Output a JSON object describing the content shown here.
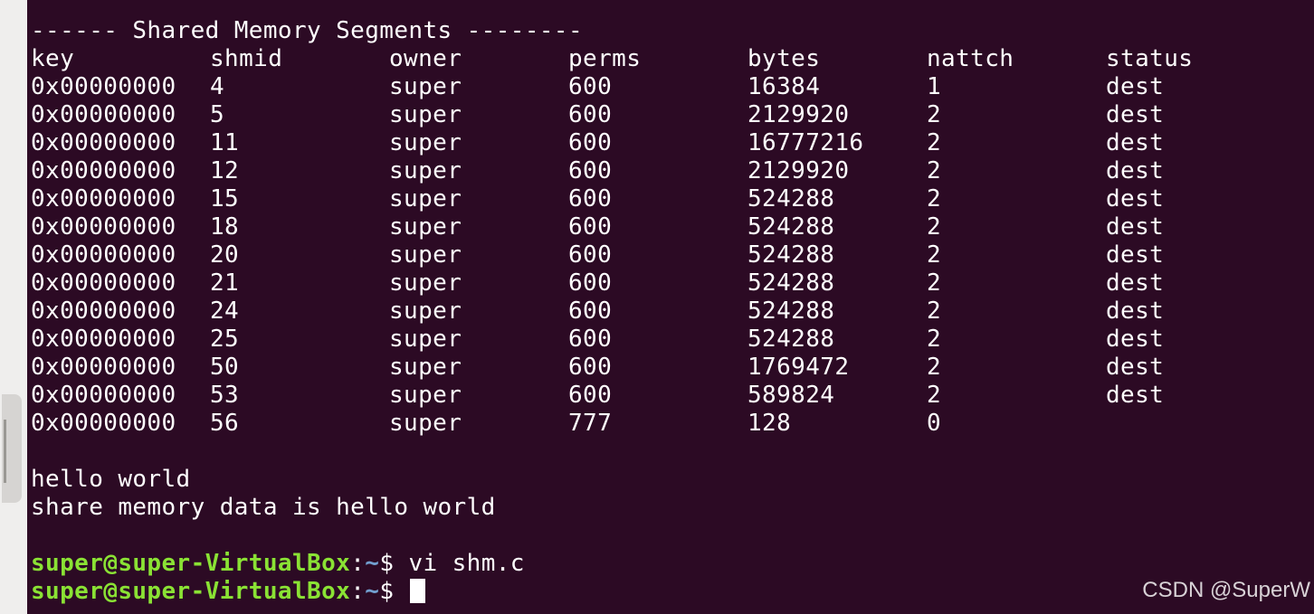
{
  "terminal": {
    "header": "------ Shared Memory Segments --------",
    "columns": [
      "key",
      "shmid",
      "owner",
      "perms",
      "bytes",
      "nattch",
      "status"
    ],
    "rows": [
      [
        "0x00000000",
        "4",
        "super",
        "600",
        "16384",
        "1",
        "dest"
      ],
      [
        "0x00000000",
        "5",
        "super",
        "600",
        "2129920",
        "2",
        "dest"
      ],
      [
        "0x00000000",
        "11",
        "super",
        "600",
        "16777216",
        "2",
        "dest"
      ],
      [
        "0x00000000",
        "12",
        "super",
        "600",
        "2129920",
        "2",
        "dest"
      ],
      [
        "0x00000000",
        "15",
        "super",
        "600",
        "524288",
        "2",
        "dest"
      ],
      [
        "0x00000000",
        "18",
        "super",
        "600",
        "524288",
        "2",
        "dest"
      ],
      [
        "0x00000000",
        "20",
        "super",
        "600",
        "524288",
        "2",
        "dest"
      ],
      [
        "0x00000000",
        "21",
        "super",
        "600",
        "524288",
        "2",
        "dest"
      ],
      [
        "0x00000000",
        "24",
        "super",
        "600",
        "524288",
        "2",
        "dest"
      ],
      [
        "0x00000000",
        "25",
        "super",
        "600",
        "524288",
        "2",
        "dest"
      ],
      [
        "0x00000000",
        "50",
        "super",
        "600",
        "1769472",
        "2",
        "dest"
      ],
      [
        "0x00000000",
        "53",
        "super",
        "600",
        "589824",
        "2",
        "dest"
      ],
      [
        "0x00000000",
        "56",
        "super",
        "777",
        "128",
        "0",
        ""
      ]
    ],
    "output_lines": [
      "hello world",
      "share memory data is hello world"
    ],
    "prompt": {
      "user_host": "super@super-VirtualBox",
      "separator": ":",
      "path": "~",
      "symbol": "$"
    },
    "commands": [
      "vi shm.c",
      ""
    ]
  },
  "watermark": "CSDN @SuperW",
  "colors": {
    "background": "#2c0a24",
    "prompt_user": "#8ae234",
    "prompt_path": "#729fcf",
    "text": "#ffffff"
  }
}
